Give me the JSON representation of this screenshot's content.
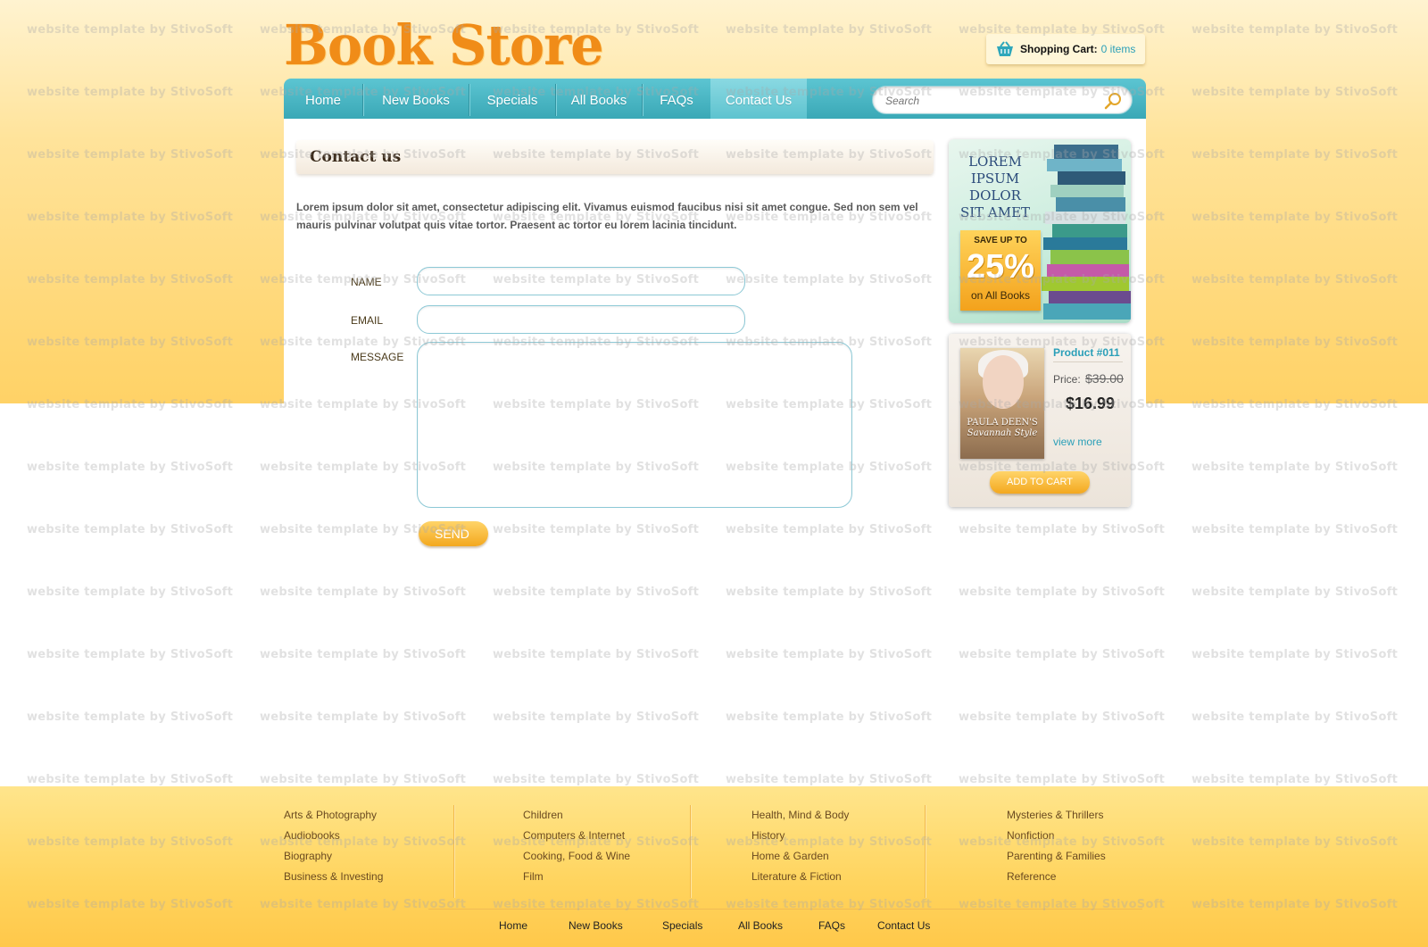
{
  "logo": {
    "text": "Book Store"
  },
  "cart": {
    "label": "Shopping Cart:",
    "count": "0 items",
    "icon": "shopping-basket-icon"
  },
  "nav": {
    "items": [
      "Home",
      "New Books",
      "Specials",
      "All Books",
      "FAQs",
      "Contact Us"
    ],
    "active": "Contact Us"
  },
  "search": {
    "placeholder": "Search",
    "icon": "magnifier-icon"
  },
  "page": {
    "title": "Contact us",
    "intro": "Lorem ipsum dolor sit amet, consectetur adipiscing elit. Vivamus euismod faucibus nisi sit amet congue. Sed non sem vel mauris pulvinar volutpat quis vitae tortor. Praesent ac tortor eu lorem lacinia tincidunt."
  },
  "form": {
    "name_label": "NAME",
    "email_label": "EMAIL",
    "message_label": "MESSAGE",
    "name_value": "",
    "email_value": "",
    "message_value": "",
    "send_label": "SEND"
  },
  "promo": {
    "headline": "LOREM IPSUM DOLOR SIT AMET",
    "save_text": "SAVE UP TO",
    "percent": "25%",
    "scope": "on All Books"
  },
  "product": {
    "name": "Product #011",
    "price_label": "Price:",
    "old_price": "$39.00",
    "new_price": "$16.99",
    "cover_title": "PAULA DEEN'S",
    "cover_subtitle": "Savannah Style",
    "view_more": "view more",
    "add_to_cart": "ADD TO CART"
  },
  "categories": [
    [
      "Arts & Photography",
      "Audiobooks",
      "Biography",
      "Business & Investing"
    ],
    [
      "Children",
      "Computers & Internet",
      "Cooking, Food & Wine",
      "Film"
    ],
    [
      "Health, Mind & Body",
      "History",
      "Home & Garden",
      "Literature & Fiction"
    ],
    [
      "Mysteries & Thrillers",
      "Nonfiction",
      "Parenting & Families",
      "Reference"
    ]
  ],
  "footer_nav": [
    "Home",
    "New Books",
    "Specials",
    "All Books",
    "FAQs",
    "Contact Us"
  ],
  "watermark": "website template by StivoSoft",
  "colors": {
    "accent": "#f08c18",
    "nav": "#3aa8b6",
    "link": "#2a9fb8",
    "button": "#f3a81e"
  }
}
